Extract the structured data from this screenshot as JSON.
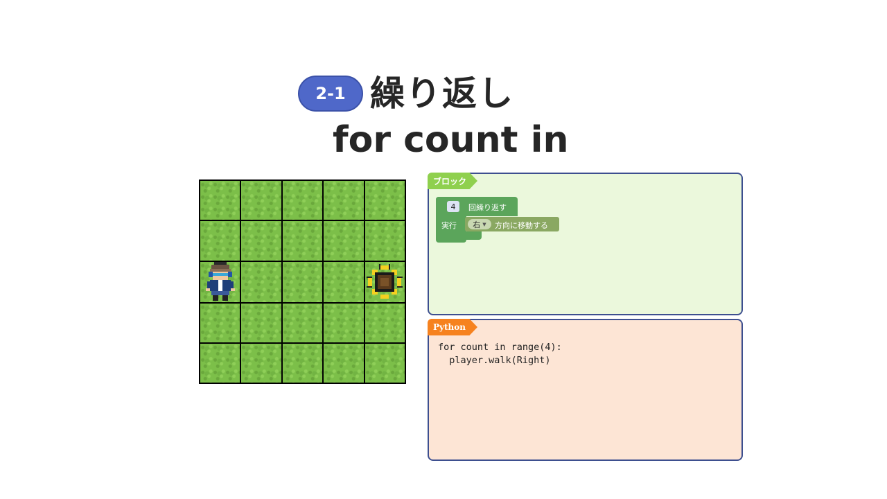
{
  "header": {
    "badge": "2-1",
    "title_jp": "繰り返し",
    "title_en": "for count in"
  },
  "grid": {
    "rows": 5,
    "cols": 5,
    "player": {
      "row": 3,
      "col": 1,
      "icon": "player-character-icon"
    },
    "goal": {
      "row": 3,
      "col": 5,
      "icon": "sunflower-icon"
    }
  },
  "blocks_panel": {
    "tag": "ブロック",
    "loop_count": "4",
    "loop_label": "回繰り返す",
    "exec_label": "実行",
    "direction": "右",
    "move_label": "方向に移動する"
  },
  "python_panel": {
    "tag": "Python",
    "code": "for count in range(4):\n  player.walk(Right)"
  },
  "colors": {
    "badge": "#4f68c9",
    "blocks_tag": "#8fd04e",
    "python_tag": "#f6821f",
    "blocks_bg": "#ebf8dc",
    "python_bg": "#fde5d5",
    "loop_block": "#5ba55b",
    "move_block": "#8aa862"
  }
}
